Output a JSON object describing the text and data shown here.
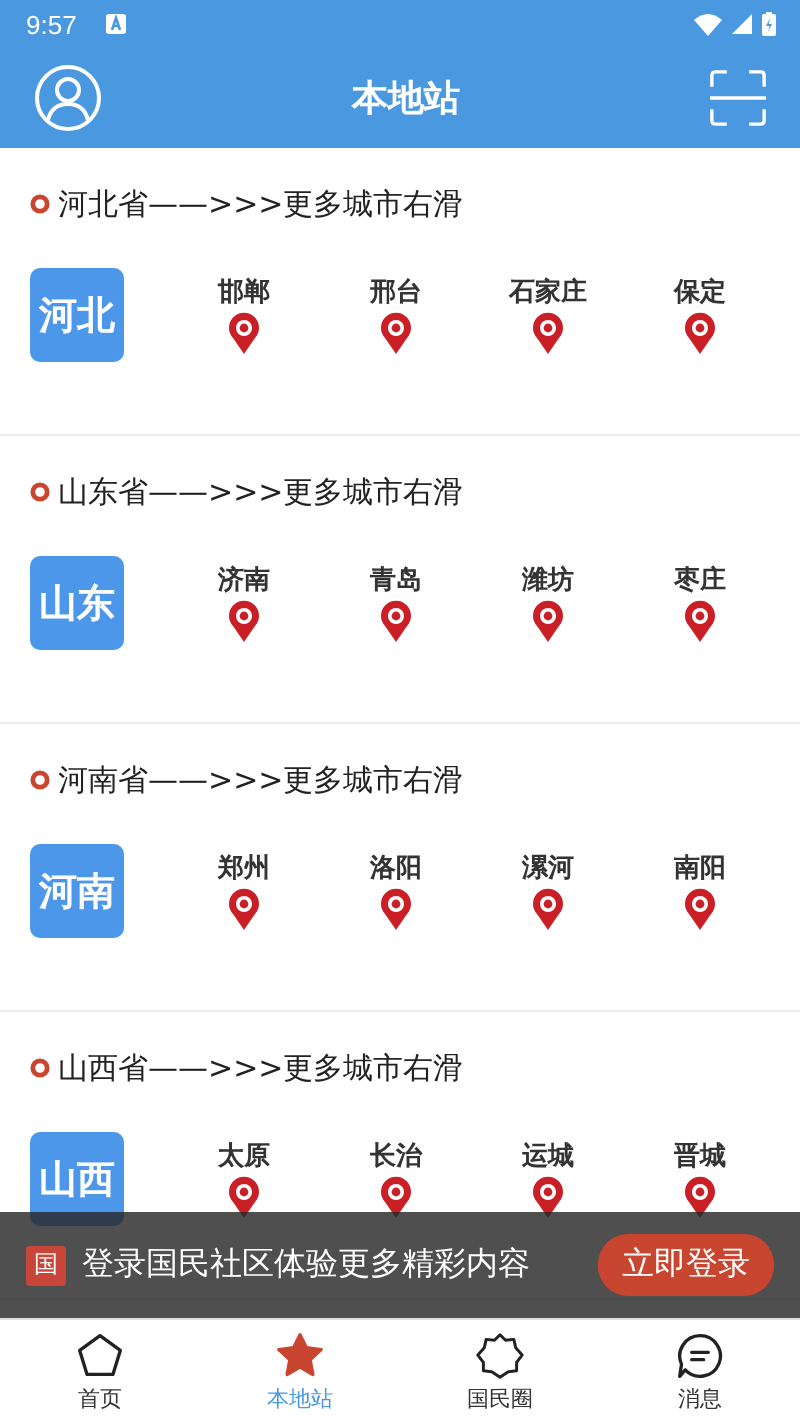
{
  "status_bar": {
    "time": "9:57"
  },
  "header": {
    "title": "本地站"
  },
  "provinces": [
    {
      "heading": "河北省——>>>更多城市右滑",
      "badge": "河北",
      "cities": [
        "邯郸",
        "邢台",
        "石家庄",
        "保定"
      ]
    },
    {
      "heading": "山东省——>>>更多城市右滑",
      "badge": "山东",
      "cities": [
        "济南",
        "青岛",
        "潍坊",
        "枣庄"
      ]
    },
    {
      "heading": "河南省——>>>更多城市右滑",
      "badge": "河南",
      "cities": [
        "郑州",
        "洛阳",
        "漯河",
        "南阳"
      ]
    },
    {
      "heading": "山西省——>>>更多城市右滑",
      "badge": "山西",
      "cities": [
        "太原",
        "长治",
        "运城",
        "晋城"
      ]
    }
  ],
  "login_banner": {
    "logo_text": "国",
    "message": "登录国民社区体验更多精彩内容",
    "button": "立即登录"
  },
  "tab_bar": [
    {
      "kind": "home",
      "label": "首页",
      "selected": false
    },
    {
      "kind": "local",
      "label": "本地站",
      "selected": true
    },
    {
      "kind": "circle",
      "label": "国民圈",
      "selected": false
    },
    {
      "kind": "messages",
      "label": "消息",
      "selected": false
    }
  ]
}
